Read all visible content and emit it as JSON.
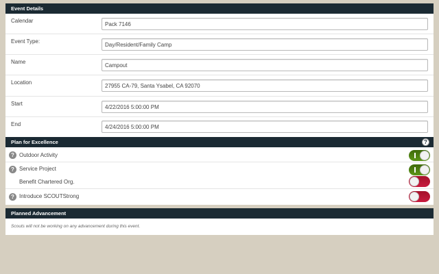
{
  "event_details": {
    "title": "Event Details",
    "fields": [
      {
        "label": "Calendar",
        "value": "Pack 7146"
      },
      {
        "label": "Event Type:",
        "value": "Day/Resident/Family Camp"
      },
      {
        "label": "Name",
        "value": "Campout"
      },
      {
        "label": "Location",
        "value": "27955 CA-79, Santa Ysabel, CA 92070"
      },
      {
        "label": "Start",
        "value": "4/22/2016 5:00:00 PM"
      },
      {
        "label": "End",
        "value": "4/24/2016 5:00:00 PM"
      }
    ]
  },
  "plan_excellence": {
    "title": "Plan for Excellence",
    "help_glyph": "?",
    "items": [
      {
        "label": "Outdoor Activity",
        "state": "on",
        "help_glyph": "?"
      },
      {
        "label": "Service Project",
        "state": "on",
        "help_glyph": "?"
      },
      {
        "label": "Benefit Chartered Org.",
        "state": "off"
      },
      {
        "label": "Introduce SCOUTStrong",
        "state": "off",
        "help_glyph": "?"
      }
    ]
  },
  "planned_advancement": {
    "title": "Planned Advancement",
    "note": "Scouts will not be working on any advancement during this event."
  },
  "colors": {
    "header_bg": "#1b2a33",
    "page_bg": "#d6cfc0",
    "toggle_on": "#4e8312",
    "toggle_off": "#c0193a"
  },
  "icons": {
    "help": "question-circle-icon"
  }
}
